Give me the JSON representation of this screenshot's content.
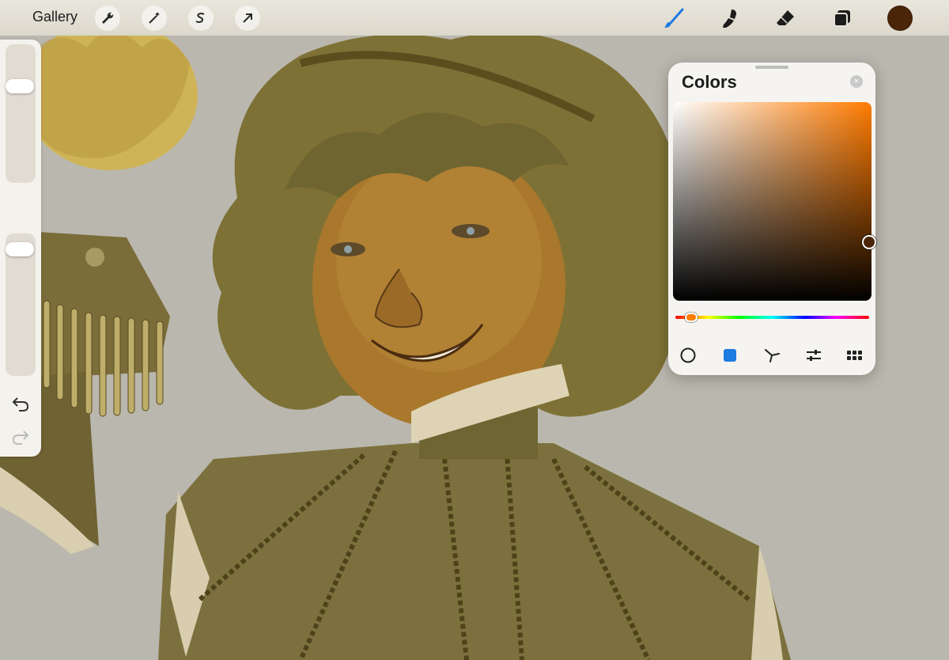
{
  "app": {
    "gallery_label": "Gallery"
  },
  "toolbar": {
    "left_tools": [
      {
        "name": "wrench-icon"
      },
      {
        "name": "magic-wand-icon"
      },
      {
        "name": "selection-s-icon"
      },
      {
        "name": "move-arrow-icon"
      }
    ],
    "right_tools": [
      {
        "name": "brush-icon",
        "active": true
      },
      {
        "name": "smudge-icon"
      },
      {
        "name": "eraser-icon"
      },
      {
        "name": "layers-icon"
      }
    ],
    "current_color": "#4a2508",
    "active_color": "#1e7be0"
  },
  "sidebar": {
    "brush_size_level": 0.72,
    "opacity_level": 0.93,
    "modify_icon": "square-icon",
    "undo_icon": "undo-icon",
    "redo_icon": "redo-icon"
  },
  "colors_panel": {
    "title": "Colors",
    "hue_color": "#ff7b00",
    "hue_level": 0.08,
    "modes": [
      {
        "name": "disc-mode-icon"
      },
      {
        "name": "classic-mode-icon",
        "active": true
      },
      {
        "name": "harmony-mode-icon"
      },
      {
        "name": "value-mode-icon"
      },
      {
        "name": "palettes-mode-icon"
      }
    ]
  }
}
